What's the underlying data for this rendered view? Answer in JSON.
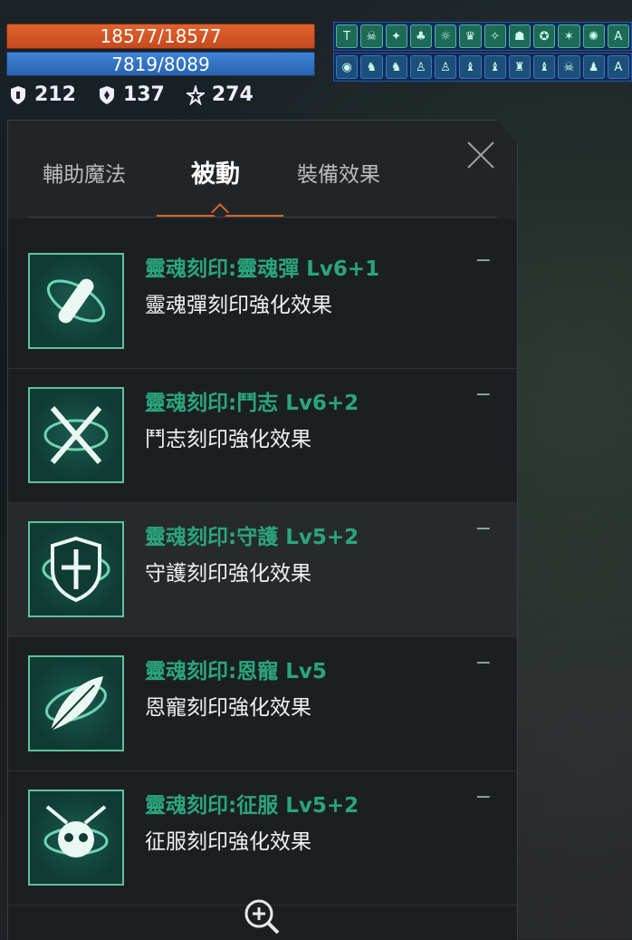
{
  "hud": {
    "hp": "18577/18577",
    "mp": "7819/8089",
    "stats": [
      "212",
      "137",
      "274"
    ]
  },
  "buffs": {
    "row1": [
      "T",
      "☠",
      "✦",
      "♣",
      "☼",
      "♛",
      "✧",
      "☗",
      "✪",
      "✶",
      "✺",
      "A"
    ],
    "row2": [
      "◉",
      "♞",
      "♞",
      "♙",
      "♙",
      "♝",
      "♝",
      "♜",
      "♝",
      "☠",
      "♟",
      "A"
    ]
  },
  "panel": {
    "tabs": [
      "輔助魔法",
      "被動",
      "裝備效果"
    ],
    "items": [
      {
        "title": "靈魂刻印:靈魂彈 Lv6+1",
        "desc": "靈魂彈刻印強化效果",
        "dash": "−"
      },
      {
        "title": "靈魂刻印:鬥志 Lv6+2",
        "desc": "鬥志刻印強化效果",
        "dash": "−"
      },
      {
        "title": "靈魂刻印:守護 Lv5+2",
        "desc": "守護刻印強化效果",
        "dash": "−"
      },
      {
        "title": "靈魂刻印:恩寵 Lv5",
        "desc": "恩寵刻印強化效果",
        "dash": "−"
      },
      {
        "title": "靈魂刻印:征服 Lv5+2",
        "desc": "征服刻印強化效果",
        "dash": "−"
      }
    ]
  }
}
